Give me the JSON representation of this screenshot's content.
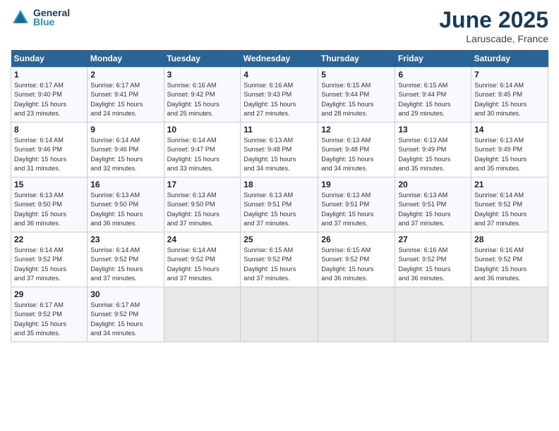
{
  "header": {
    "logo_line1": "General",
    "logo_line2": "Blue",
    "month": "June 2025",
    "location": "Laruscade, France"
  },
  "weekdays": [
    "Sunday",
    "Monday",
    "Tuesday",
    "Wednesday",
    "Thursday",
    "Friday",
    "Saturday"
  ],
  "weeks": [
    [
      {
        "day": "1",
        "detail": "Sunrise: 6:17 AM\nSunset: 9:40 PM\nDaylight: 15 hours\nand 23 minutes."
      },
      {
        "day": "2",
        "detail": "Sunrise: 6:17 AM\nSunset: 9:41 PM\nDaylight: 15 hours\nand 24 minutes."
      },
      {
        "day": "3",
        "detail": "Sunrise: 6:16 AM\nSunset: 9:42 PM\nDaylight: 15 hours\nand 25 minutes."
      },
      {
        "day": "4",
        "detail": "Sunrise: 6:16 AM\nSunset: 9:43 PM\nDaylight: 15 hours\nand 27 minutes."
      },
      {
        "day": "5",
        "detail": "Sunrise: 6:15 AM\nSunset: 9:44 PM\nDaylight: 15 hours\nand 28 minutes."
      },
      {
        "day": "6",
        "detail": "Sunrise: 6:15 AM\nSunset: 9:44 PM\nDaylight: 15 hours\nand 29 minutes."
      },
      {
        "day": "7",
        "detail": "Sunrise: 6:14 AM\nSunset: 9:45 PM\nDaylight: 15 hours\nand 30 minutes."
      }
    ],
    [
      {
        "day": "8",
        "detail": "Sunrise: 6:14 AM\nSunset: 9:46 PM\nDaylight: 15 hours\nand 31 minutes."
      },
      {
        "day": "9",
        "detail": "Sunrise: 6:14 AM\nSunset: 9:46 PM\nDaylight: 15 hours\nand 32 minutes."
      },
      {
        "day": "10",
        "detail": "Sunrise: 6:14 AM\nSunset: 9:47 PM\nDaylight: 15 hours\nand 33 minutes."
      },
      {
        "day": "11",
        "detail": "Sunrise: 6:13 AM\nSunset: 9:48 PM\nDaylight: 15 hours\nand 34 minutes."
      },
      {
        "day": "12",
        "detail": "Sunrise: 6:13 AM\nSunset: 9:48 PM\nDaylight: 15 hours\nand 34 minutes."
      },
      {
        "day": "13",
        "detail": "Sunrise: 6:13 AM\nSunset: 9:49 PM\nDaylight: 15 hours\nand 35 minutes."
      },
      {
        "day": "14",
        "detail": "Sunrise: 6:13 AM\nSunset: 9:49 PM\nDaylight: 15 hours\nand 35 minutes."
      }
    ],
    [
      {
        "day": "15",
        "detail": "Sunrise: 6:13 AM\nSunset: 9:50 PM\nDaylight: 15 hours\nand 36 minutes."
      },
      {
        "day": "16",
        "detail": "Sunrise: 6:13 AM\nSunset: 9:50 PM\nDaylight: 15 hours\nand 36 minutes."
      },
      {
        "day": "17",
        "detail": "Sunrise: 6:13 AM\nSunset: 9:50 PM\nDaylight: 15 hours\nand 37 minutes."
      },
      {
        "day": "18",
        "detail": "Sunrise: 6:13 AM\nSunset: 9:51 PM\nDaylight: 15 hours\nand 37 minutes."
      },
      {
        "day": "19",
        "detail": "Sunrise: 6:13 AM\nSunset: 9:51 PM\nDaylight: 15 hours\nand 37 minutes."
      },
      {
        "day": "20",
        "detail": "Sunrise: 6:13 AM\nSunset: 9:51 PM\nDaylight: 15 hours\nand 37 minutes."
      },
      {
        "day": "21",
        "detail": "Sunrise: 6:14 AM\nSunset: 9:52 PM\nDaylight: 15 hours\nand 37 minutes."
      }
    ],
    [
      {
        "day": "22",
        "detail": "Sunrise: 6:14 AM\nSunset: 9:52 PM\nDaylight: 15 hours\nand 37 minutes."
      },
      {
        "day": "23",
        "detail": "Sunrise: 6:14 AM\nSunset: 9:52 PM\nDaylight: 15 hours\nand 37 minutes."
      },
      {
        "day": "24",
        "detail": "Sunrise: 6:14 AM\nSunset: 9:52 PM\nDaylight: 15 hours\nand 37 minutes."
      },
      {
        "day": "25",
        "detail": "Sunrise: 6:15 AM\nSunset: 9:52 PM\nDaylight: 15 hours\nand 37 minutes."
      },
      {
        "day": "26",
        "detail": "Sunrise: 6:15 AM\nSunset: 9:52 PM\nDaylight: 15 hours\nand 36 minutes."
      },
      {
        "day": "27",
        "detail": "Sunrise: 6:16 AM\nSunset: 9:52 PM\nDaylight: 15 hours\nand 36 minutes."
      },
      {
        "day": "28",
        "detail": "Sunrise: 6:16 AM\nSunset: 9:52 PM\nDaylight: 15 hours\nand 36 minutes."
      }
    ],
    [
      {
        "day": "29",
        "detail": "Sunrise: 6:17 AM\nSunset: 9:52 PM\nDaylight: 15 hours\nand 35 minutes."
      },
      {
        "day": "30",
        "detail": "Sunrise: 6:17 AM\nSunset: 9:52 PM\nDaylight: 15 hours\nand 34 minutes."
      },
      null,
      null,
      null,
      null,
      null
    ]
  ]
}
